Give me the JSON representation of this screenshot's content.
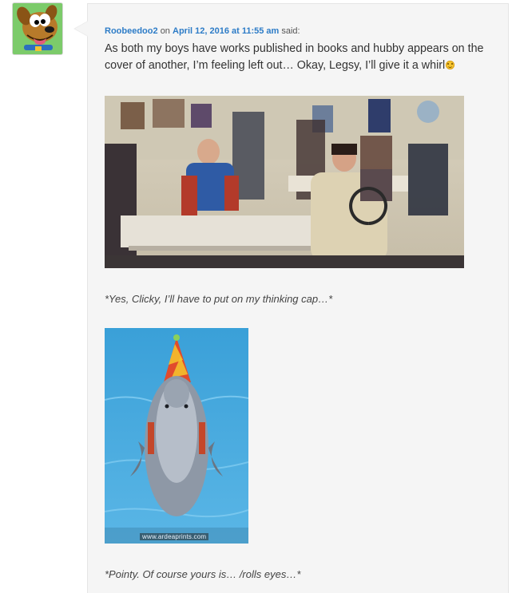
{
  "comment": {
    "author": "Roobeedoo2",
    "on_word": "on",
    "date": "April 12, 2016 at 11:55 am",
    "said_word": "said:",
    "text": "As both my boys have works published in books and hubby appears on the cover of another, I’m feeling left out… Okay, Legsy, I’ll give it a whirl",
    "emoji_icon": "smiley-icon",
    "image1_caption": "*Yes, Clicky, I’ll have to put on my thinking cap…*",
    "image2_watermark": "www.ardeaprints.com",
    "image2_caption": "*Pointy. Of course yours is… /rolls eyes…*"
  },
  "colors": {
    "link": "#2d7cc7",
    "bubble_bg": "#f5f5f5",
    "text": "#333333"
  },
  "icons": {
    "avatar": "scooby-doo-avatar"
  }
}
